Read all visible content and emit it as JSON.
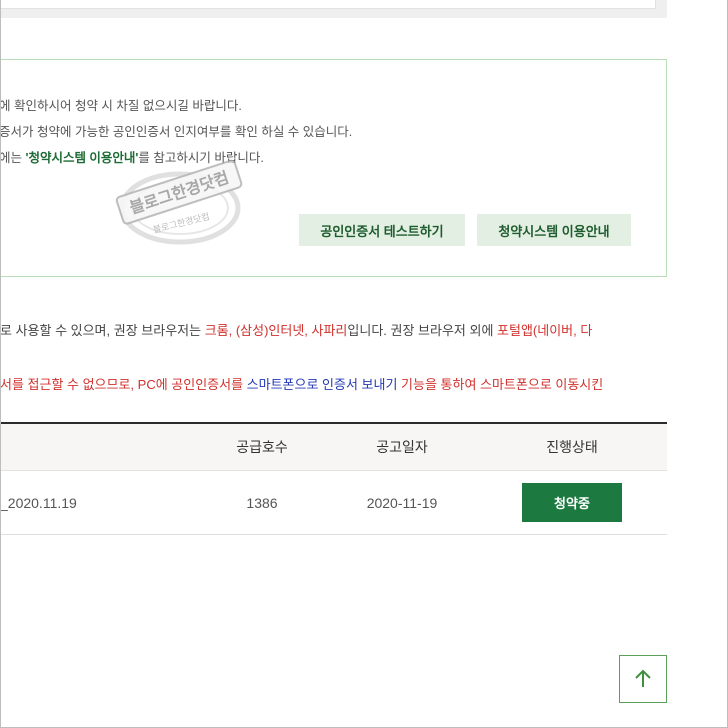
{
  "notice": {
    "line1": "에 확인하시어 청약 시 차질 없으시길 바랍니다.",
    "line2": "증서가 청약에 가능한 공인인증서 인지여부를 확인 하실 수 있습니다.",
    "line3_prefix": "에는 ",
    "line3_highlight": "'청약시스템 이용안내'",
    "line3_suffix": "를 참고하시기 바랍니다.",
    "cert_test_button": "공인인증서 테스트하기",
    "system_guide_button": "청약시스템 이용안내"
  },
  "watermark": {
    "text": "블로그한경닷컴",
    "ring_text": "블로그한경닷컴"
  },
  "browser_note": {
    "l1_a": "로 사용할 수 있으며, 권장 브라우저는 ",
    "l1_b": "크롬, (삼성)인터넷, 사파리",
    "l1_c": "입니다. 권장 브라우저 외에 ",
    "l1_d": "포털앱(네이버, 다",
    "l2_a": "서를 접근할 수 없으므로, PC에 공인인증서를 ",
    "l2_b": "스마트폰으로 인증서 보내기",
    "l2_c": " 기능을 통하여 스마트폰으로 이동시킨"
  },
  "table": {
    "headers": {
      "units": "공급호수",
      "date": "공고일자",
      "status": "진행상태"
    },
    "rows": [
      {
        "name": "_2020.11.19",
        "units": "1386",
        "date": "2020-11-19",
        "status": "청약중"
      }
    ]
  },
  "scroll_top": {
    "icon": "arrow-up-icon"
  },
  "colors": {
    "accent_green": "#1c7a41",
    "light_green": "#e3efe3",
    "highlight_red": "#d0312d",
    "highlight_blue": "#2339b6"
  }
}
